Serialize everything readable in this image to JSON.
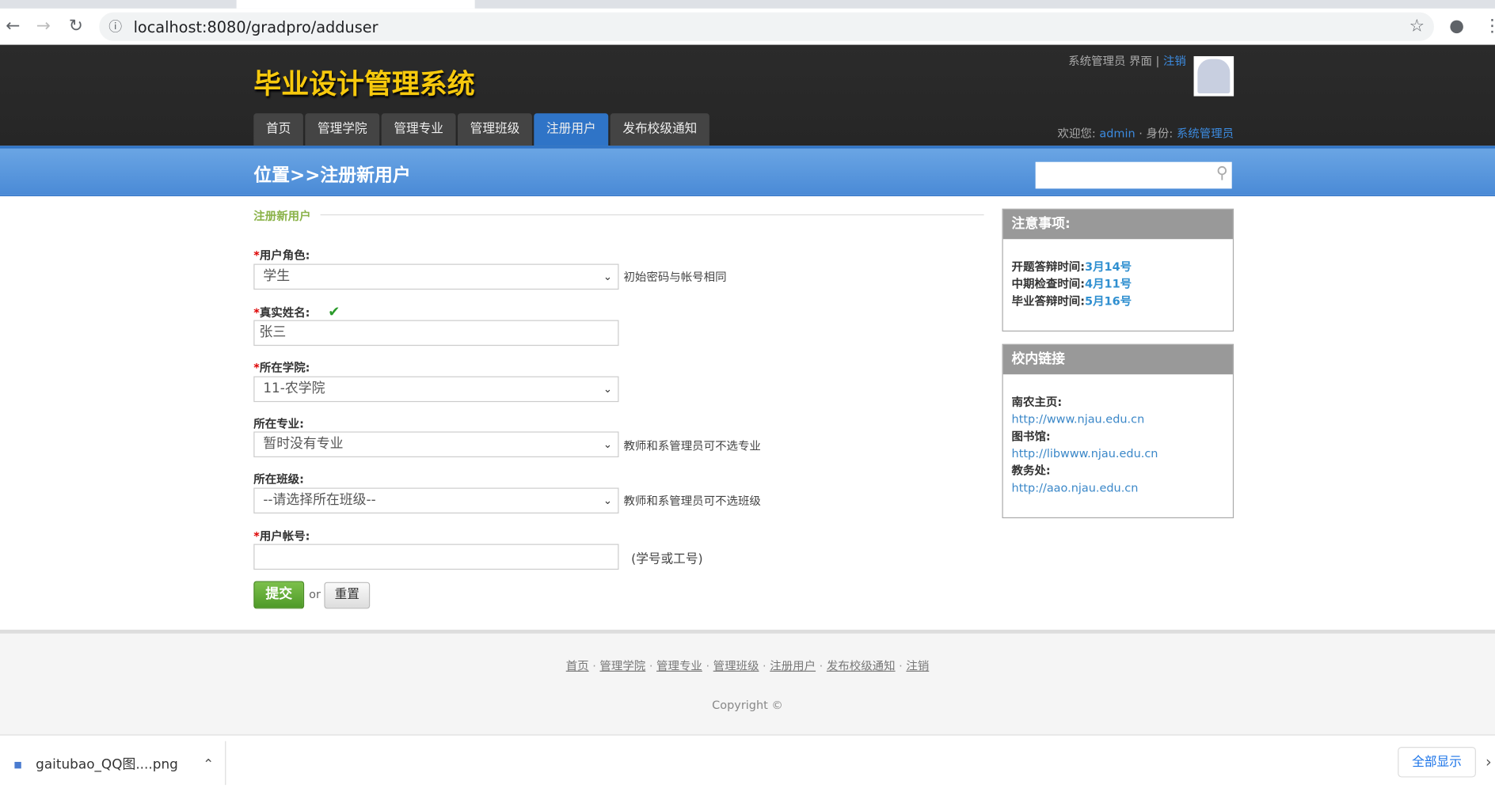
{
  "browser": {
    "url": "localhost:8080/gradpro/adduser"
  },
  "header": {
    "logo": "毕业设计管理系统",
    "role_text": "系统管理员 界面",
    "logout": "注销",
    "welcome_label": "欢迎您:",
    "username": "admin",
    "identity_label": "· 身份:",
    "identity": "系统管理员",
    "menu": [
      {
        "label": "首页"
      },
      {
        "label": "管理学院"
      },
      {
        "label": "管理专业"
      },
      {
        "label": "管理班级"
      },
      {
        "label": "注册用户",
        "active": true
      },
      {
        "label": "发布校级通知"
      }
    ]
  },
  "location": {
    "breadcrumb": "位置>>注册新用户",
    "search_placeholder": ""
  },
  "form": {
    "section_title": "注册新用户",
    "role": {
      "label": "用户角色:",
      "value": "学生",
      "hint": "初始密码与帐号相同"
    },
    "name": {
      "label": "真实姓名:",
      "value": "张三"
    },
    "college": {
      "label": "所在学院:",
      "value": "11-农学院"
    },
    "major": {
      "label": "所在专业:",
      "value": "暂时没有专业",
      "hint": "教师和系管理员可不选专业"
    },
    "class": {
      "label": "所在班级:",
      "value": "--请选择所在班级--",
      "hint": "教师和系管理员可不选班级"
    },
    "account": {
      "label": "用户帐号:",
      "value": "",
      "hint": "(学号或工号)"
    },
    "required_mark": "*",
    "submit": "提交",
    "or": "or",
    "reset": "重置"
  },
  "notice": {
    "title": "注意事项:",
    "items": [
      {
        "label": "开题答辩时间:",
        "value": "3月14号"
      },
      {
        "label": "中期检查时间:",
        "value": "4月11号"
      },
      {
        "label": "毕业答辩时间:",
        "value": "5月16号"
      }
    ]
  },
  "links": {
    "title": "校内链接",
    "items": [
      {
        "label": "南农主页:",
        "url": "http://www.njau.edu.cn"
      },
      {
        "label": "图书馆:",
        "url": "http://libwww.njau.edu.cn"
      },
      {
        "label": "教务处:",
        "url": "http://aao.njau.edu.cn"
      }
    ]
  },
  "footer": {
    "links": [
      "首页",
      "管理学院",
      "管理专业",
      "管理班级",
      "注册用户",
      "发布校级通知",
      "注销"
    ],
    "copyright": "Copyright ©"
  },
  "download": {
    "file": "gaitubao_QQ图....png",
    "show_all": "全部显示"
  },
  "colors": {
    "accent": "#2f74c7",
    "logo": "#f7c90d",
    "section": "#8bb34a"
  }
}
